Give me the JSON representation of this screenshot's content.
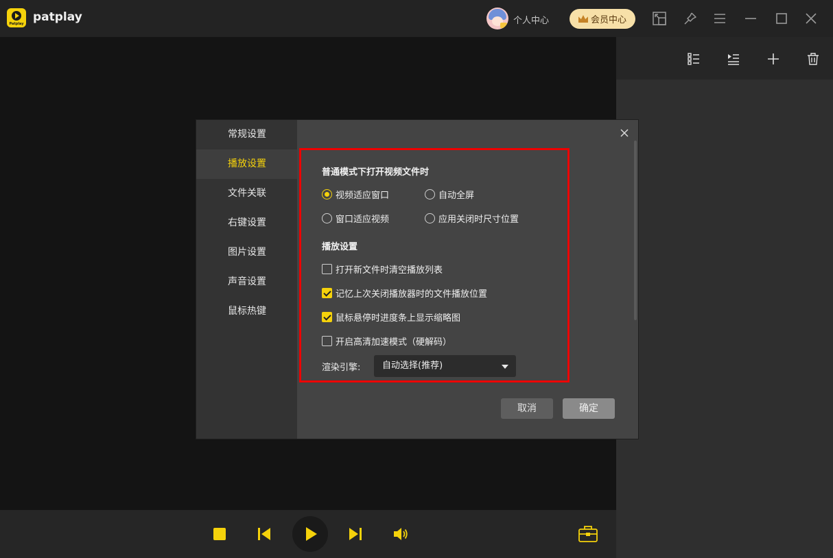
{
  "app": {
    "logo_text": "Patplay",
    "title": "patplay"
  },
  "header": {
    "profile_label": "个人中心",
    "vip_label": "会员中心"
  },
  "dialog": {
    "nav": [
      {
        "label": "常规设置"
      },
      {
        "label": "播放设置",
        "active": true
      },
      {
        "label": "文件关联"
      },
      {
        "label": "右键设置"
      },
      {
        "label": "图片设置"
      },
      {
        "label": "声音设置"
      },
      {
        "label": "鼠标热键"
      }
    ],
    "open_mode": {
      "title": "普通模式下打开视频文件时",
      "options": [
        {
          "label": "视频适应窗口",
          "selected": true
        },
        {
          "label": "自动全屏",
          "selected": false
        },
        {
          "label": "窗口适应视频",
          "selected": false
        },
        {
          "label": "应用关闭时尺寸位置",
          "selected": false
        }
      ]
    },
    "playback": {
      "title": "播放设置",
      "options": [
        {
          "label": "打开新文件时清空播放列表",
          "checked": false
        },
        {
          "label": "记忆上次关闭播放器时的文件播放位置",
          "checked": true
        },
        {
          "label": "鼠标悬停时进度条上显示缩略图",
          "checked": true
        },
        {
          "label": "开启高清加速模式（硬解码）",
          "checked": false
        }
      ]
    },
    "render": {
      "label": "渲染引擎:",
      "value": "自动选择(推荐)"
    },
    "buttons": {
      "cancel": "取消",
      "ok": "确定"
    }
  },
  "colors": {
    "accent": "#f5d20b",
    "highlight_border": "#ee0000",
    "vip_bg": "#f7e0a8"
  },
  "icons": {
    "window": [
      "mini-mode-icon",
      "pin-icon",
      "menu-icon",
      "minimize-icon",
      "maximize-icon",
      "close-icon"
    ],
    "playlist": [
      "list-view-icon",
      "play-list-icon",
      "add-icon",
      "delete-icon"
    ],
    "controls": [
      "stop-icon",
      "previous-icon",
      "play-icon",
      "next-icon",
      "volume-icon",
      "toolbox-icon"
    ]
  }
}
